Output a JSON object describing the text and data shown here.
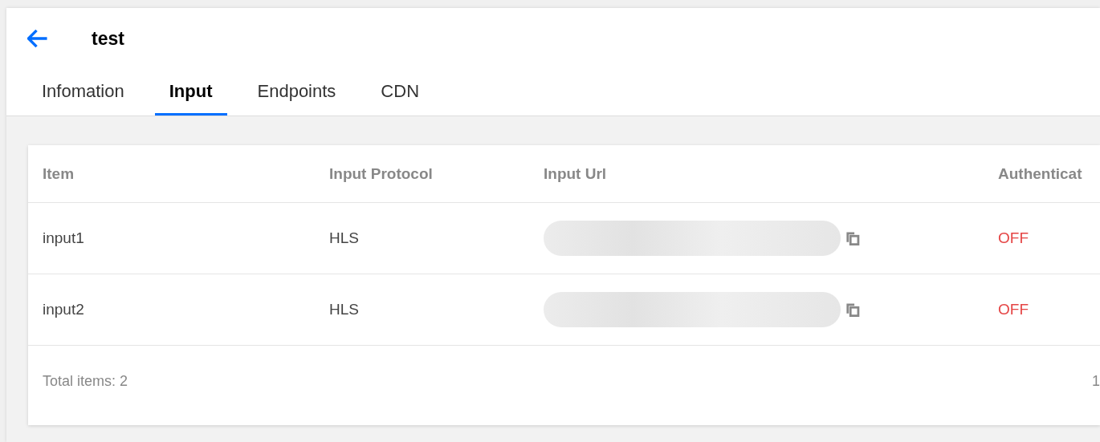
{
  "header": {
    "title": "test"
  },
  "tabs": [
    {
      "label": "Infomation",
      "selected": false
    },
    {
      "label": "Input",
      "selected": true
    },
    {
      "label": "Endpoints",
      "selected": false
    },
    {
      "label": "CDN",
      "selected": false
    }
  ],
  "table": {
    "columns": [
      "Item",
      "Input Protocol",
      "Input Url",
      "Authenticat"
    ],
    "rows": [
      {
        "item": "input1",
        "protocol": "HLS",
        "authentication": "OFF"
      },
      {
        "item": "input2",
        "protocol": "HLS",
        "authentication": "OFF"
      }
    ],
    "footer": {
      "total": "Total items:  2",
      "pagination": "1"
    }
  }
}
